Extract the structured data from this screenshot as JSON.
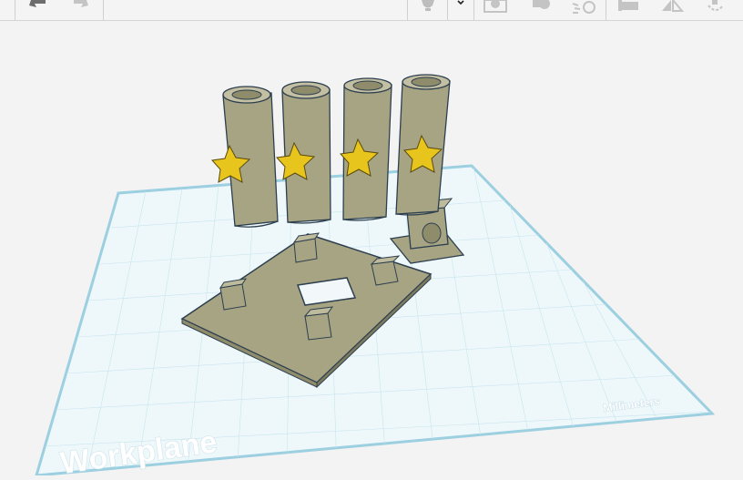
{
  "toolbar": {
    "items": [
      {
        "name": "undo-icon"
      },
      {
        "name": "redo-icon"
      },
      {
        "name": "lightbulb-icon"
      },
      {
        "name": "chevron-down-icon"
      },
      {
        "name": "group-icon"
      },
      {
        "name": "ungroup-icon"
      },
      {
        "name": "workplane-tool-icon"
      },
      {
        "name": "align-icon"
      },
      {
        "name": "mirror-icon"
      },
      {
        "name": "cruise-icon"
      }
    ]
  },
  "workplane": {
    "label": "Workplane",
    "units_label": "Millimeters"
  },
  "colors": {
    "grid": "#bfe0ea",
    "plate_edge": "#8ec9dd",
    "shape_fill": "#a7a483",
    "shape_edge": "#2d3f4f",
    "star_fill": "#e8c51c"
  }
}
